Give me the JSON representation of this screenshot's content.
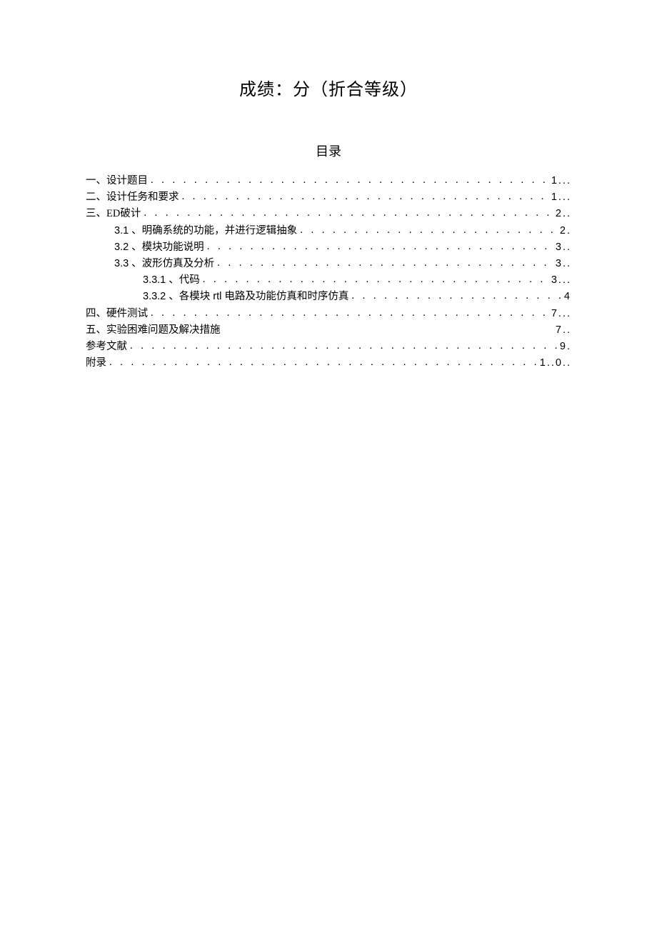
{
  "title": "成绩：分（折合等级）",
  "toc_title": "目录",
  "toc": [
    {
      "indent": 0,
      "label": "一、设计题目",
      "page": "1..."
    },
    {
      "indent": 0,
      "label": "二、设计任务和要求",
      "page": "1..."
    },
    {
      "indent": 0,
      "label": "三、ED破计",
      "page": "2.."
    },
    {
      "indent": 1,
      "label": "3.1 、明确系统的功能，并进行逻辑抽象",
      "page": "2."
    },
    {
      "indent": 1,
      "label": "3.2 、模块功能说明",
      "page": "3.."
    },
    {
      "indent": 1,
      "label": "3.3 、波形仿真及分析",
      "page": "3.."
    },
    {
      "indent": 2,
      "label": "3.3.1 、代码",
      "page": "3..."
    },
    {
      "indent": 2,
      "label": "3.3.2 、各模块 rtl 电路及功能仿真和时序仿真",
      "page": "4"
    },
    {
      "indent": 0,
      "label": "四、硬件测试",
      "page": "7..."
    },
    {
      "indent": 0,
      "label": "五、实验困难问题及解决措施",
      "page": "7.."
    },
    {
      "indent": 0,
      "label": "参考文献",
      "page": "9."
    },
    {
      "indent": 0,
      "label": "附录",
      "page": "1..0.."
    }
  ]
}
